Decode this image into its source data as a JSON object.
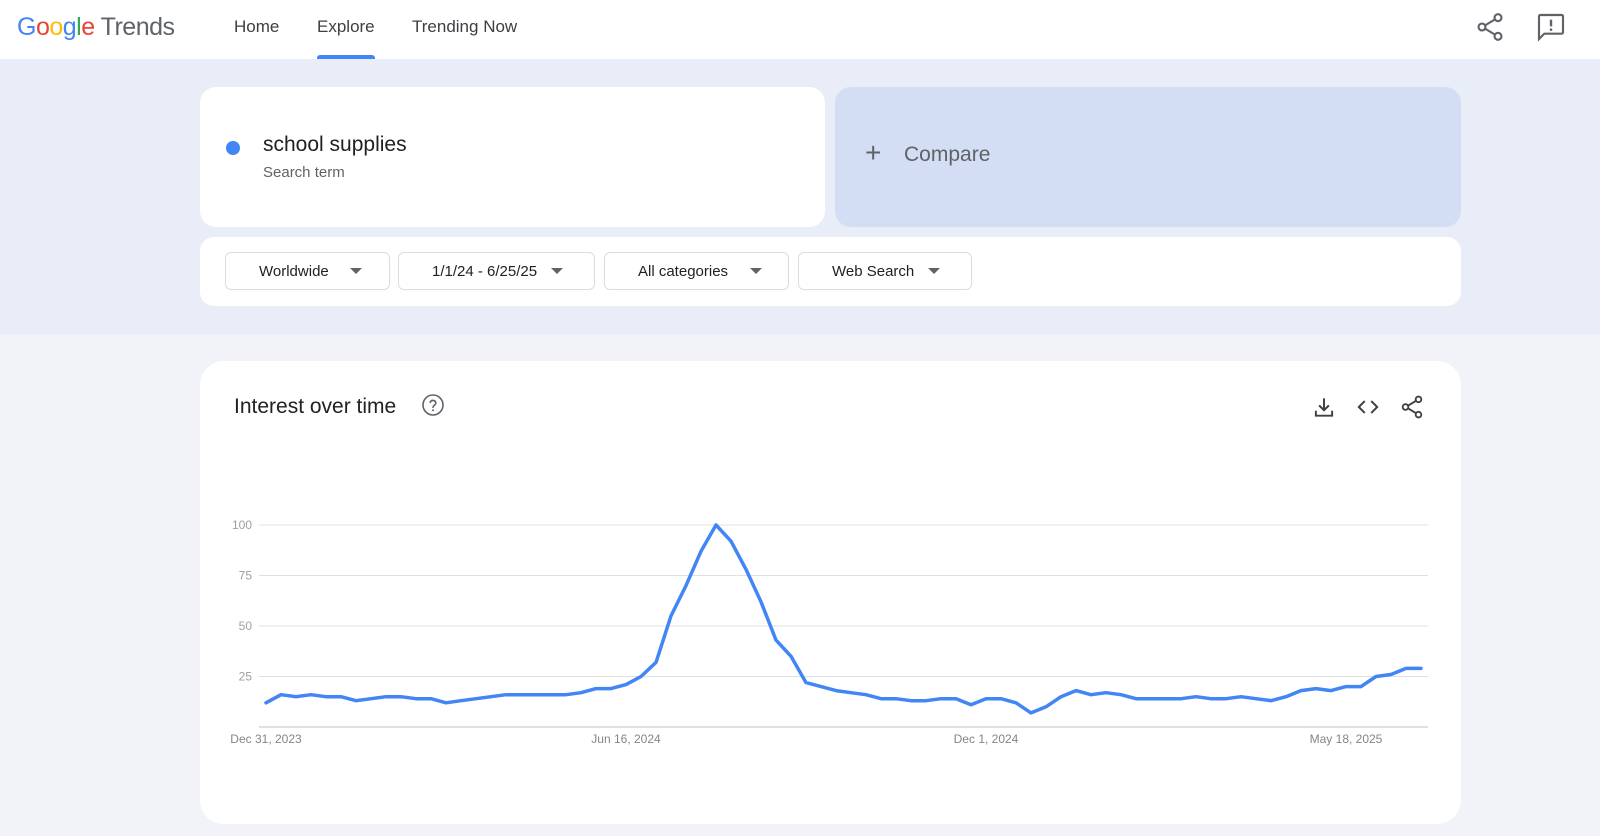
{
  "header": {
    "logo_google": [
      "G",
      "o",
      "o",
      "g",
      "l",
      "e"
    ],
    "logo_product": "Trends",
    "nav": [
      "Home",
      "Explore",
      "Trending Now"
    ],
    "active_nav": "Explore",
    "icons": [
      "share-icon",
      "feedback-icon"
    ]
  },
  "search": {
    "term": "school supplies",
    "term_type": "Search term",
    "term_color": "#4285f4",
    "compare_label": "Compare"
  },
  "filters": {
    "region": "Worldwide",
    "date_range": "1/1/24 - 6/25/25",
    "category": "All categories",
    "search_type": "Web Search"
  },
  "chart_card": {
    "title": "Interest over time",
    "icons": [
      "help-icon",
      "download-icon",
      "embed-icon",
      "share-icon"
    ]
  },
  "chart_data": {
    "type": "line",
    "title": "Interest over time",
    "xlabel": "",
    "ylabel": "",
    "y_ticks": [
      "100",
      "75",
      "50",
      "25"
    ],
    "y_tick_values": [
      100,
      75,
      50,
      25
    ],
    "ylim": [
      0,
      100
    ],
    "x_tick_labels": [
      "Dec 31, 2023",
      "Jun 16, 2024",
      "Dec 1, 2024",
      "May 18, 2025"
    ],
    "x_tick_indices": [
      0,
      24,
      48,
      72
    ],
    "grid": true,
    "line_color": "#4285f4",
    "series": [
      {
        "values": [
          12,
          16,
          15,
          16,
          15,
          15,
          13,
          14,
          15,
          15,
          14,
          14,
          12,
          13,
          14,
          15,
          16,
          16,
          16,
          16,
          16,
          17,
          19,
          19,
          21,
          25,
          32,
          55,
          70,
          87,
          100,
          92,
          78,
          62,
          43,
          35,
          22,
          20,
          18,
          17,
          16,
          14,
          14,
          13,
          13,
          14,
          14,
          11,
          14,
          14,
          12,
          7,
          10,
          15,
          18,
          16,
          17,
          16,
          14,
          14,
          14,
          14,
          15,
          14,
          14,
          15,
          14,
          13,
          15,
          18,
          19,
          18,
          20,
          20,
          25,
          26,
          29,
          29
        ]
      }
    ]
  }
}
